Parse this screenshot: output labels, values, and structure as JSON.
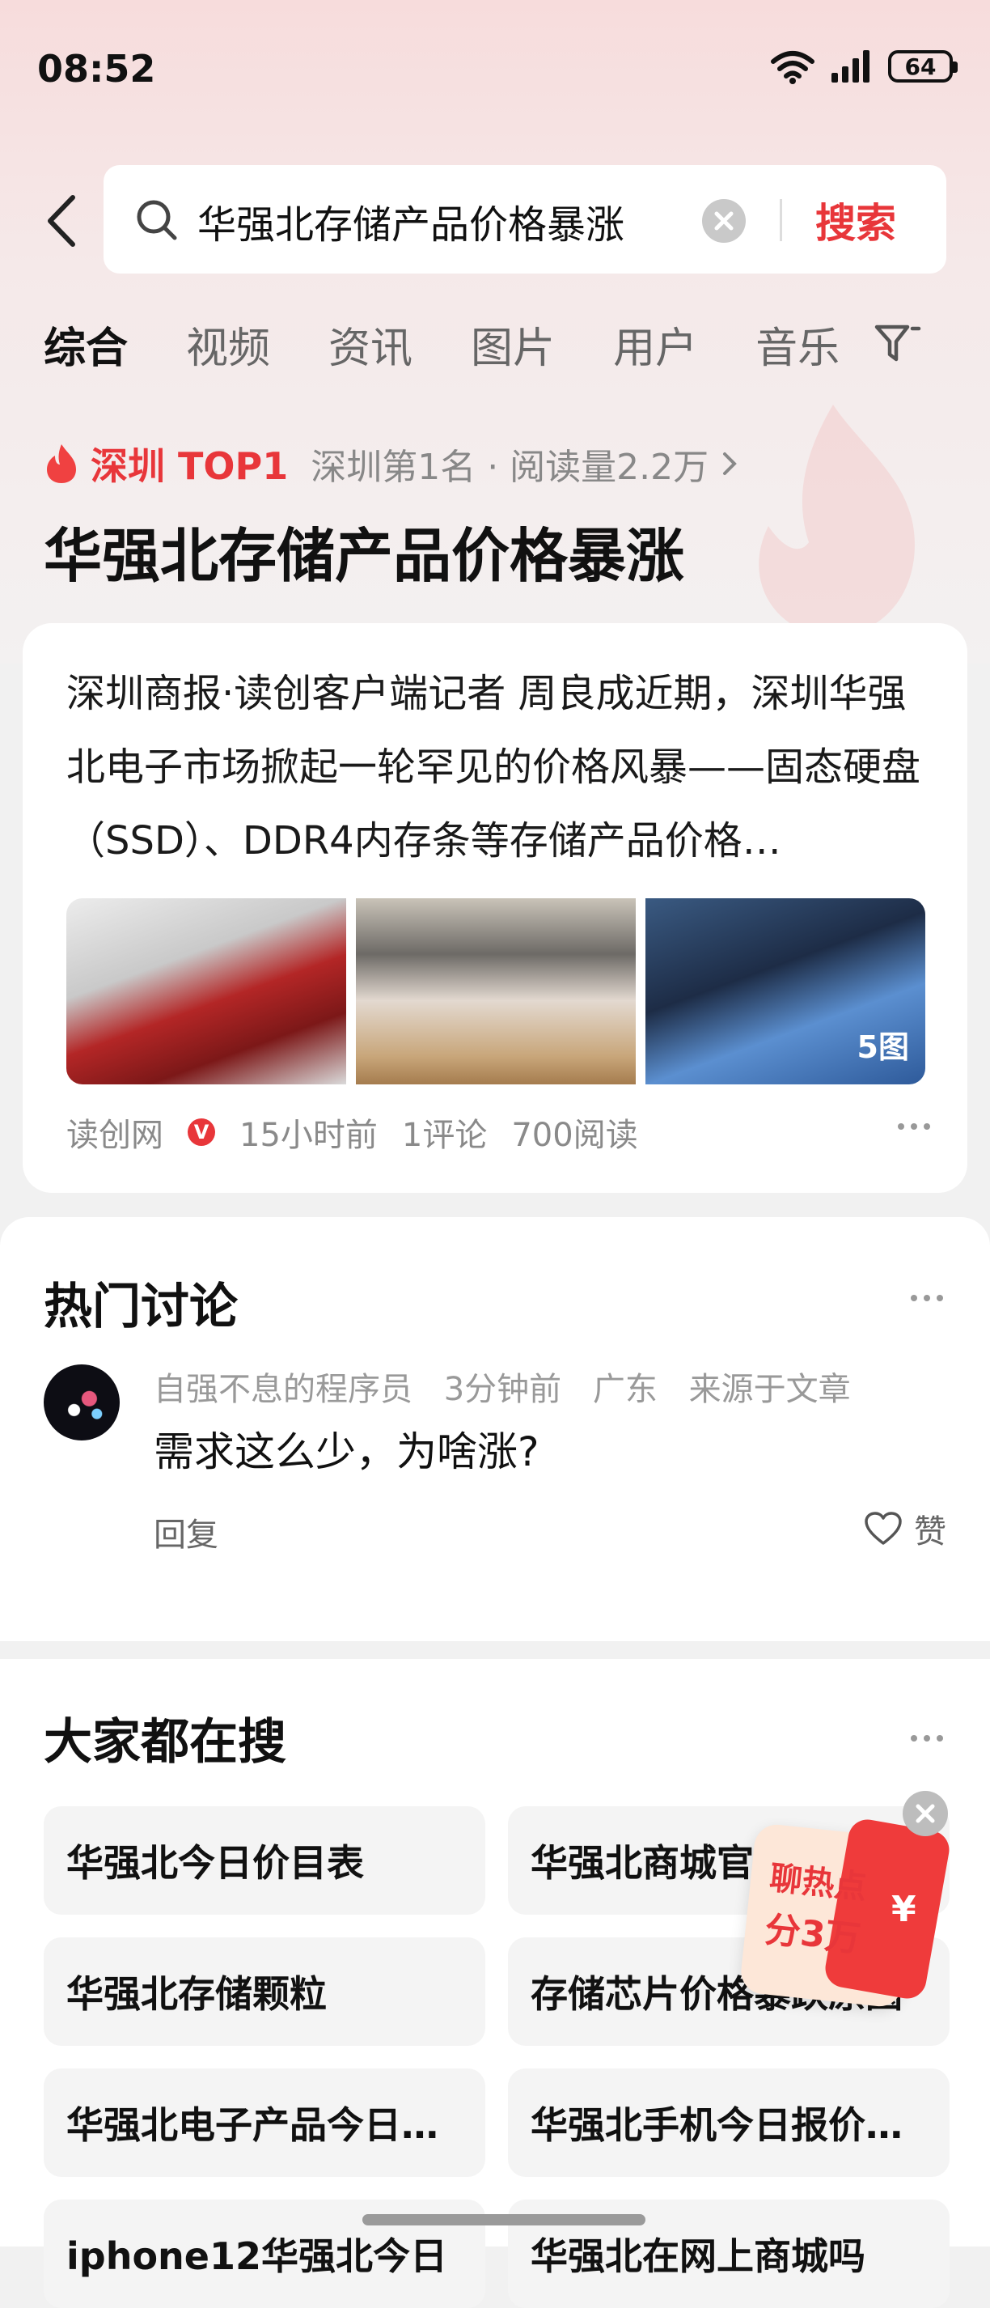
{
  "status_bar": {
    "time": "08:52",
    "battery": "64"
  },
  "search": {
    "query": "华强北存储产品价格暴涨",
    "button_label": "搜索"
  },
  "tabs": [
    {
      "label": "综合"
    },
    {
      "label": "视频"
    },
    {
      "label": "资讯"
    },
    {
      "label": "图片"
    },
    {
      "label": "用户"
    },
    {
      "label": "音乐"
    }
  ],
  "hot": {
    "rank_label": "深圳 TOP1",
    "sub": "深圳第1名 · 阅读量2.2万",
    "headline": "华强北存储产品价格暴涨"
  },
  "article": {
    "text": "深圳商报·读创客户端记者 周良成近期，深圳华强北电子市场掀起一轮罕见的价格风暴——固态硬盘（SSD）、DDR4内存条等存储产品价格…",
    "image_count": "5图",
    "source": "读创网",
    "verified_badge": "V",
    "time": "15小时前",
    "comments": "1评论",
    "reads": "700阅读"
  },
  "discussion": {
    "title": "热门讨论",
    "comment": {
      "user": "自强不息的程序员",
      "time": "3分钟前",
      "location": "广东",
      "origin": "来源于文章",
      "text": "需求这么少，为啥涨?",
      "reply_label": "回复",
      "like_label": "赞"
    }
  },
  "everyone_searches": {
    "title": "大家都在搜",
    "items": [
      "华强北今日价目表",
      "华强北商城官",
      "华强北存储颗粒",
      "存储芯片价格暴跌原因",
      "华强北电子产品今日…",
      "华强北手机今日报价…",
      "iphone12华强北今日",
      "华强北在网上商城吗"
    ]
  },
  "promo": {
    "line1": "聊热点",
    "line2": "分3万",
    "currency": "¥"
  },
  "colors": {
    "accent": "#e8363a"
  }
}
